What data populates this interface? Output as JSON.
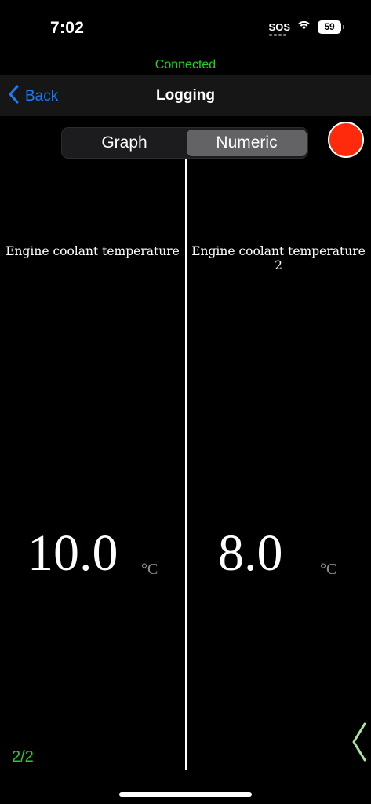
{
  "status_bar": {
    "time": "7:02",
    "sos": "SOS",
    "battery": "59"
  },
  "connection": {
    "status": "Connected",
    "color": "#21d321"
  },
  "navbar": {
    "back_label": "Back",
    "title": "Logging",
    "accent": "#1e7cf6"
  },
  "segmented_control": {
    "options": [
      "Graph",
      "Numeric"
    ],
    "selected": "Numeric"
  },
  "record_button": {
    "icon": "record-circle-icon",
    "color": "#ff2a0c"
  },
  "gauges": [
    {
      "label": "Engine coolant temperature",
      "value": "10.0",
      "unit": "°C"
    },
    {
      "label": "Engine coolant temperature 2",
      "value": "8.0",
      "unit": "°C"
    }
  ],
  "pagination": {
    "indicator": "2/2",
    "next_icon": "chevron-left-icon"
  }
}
